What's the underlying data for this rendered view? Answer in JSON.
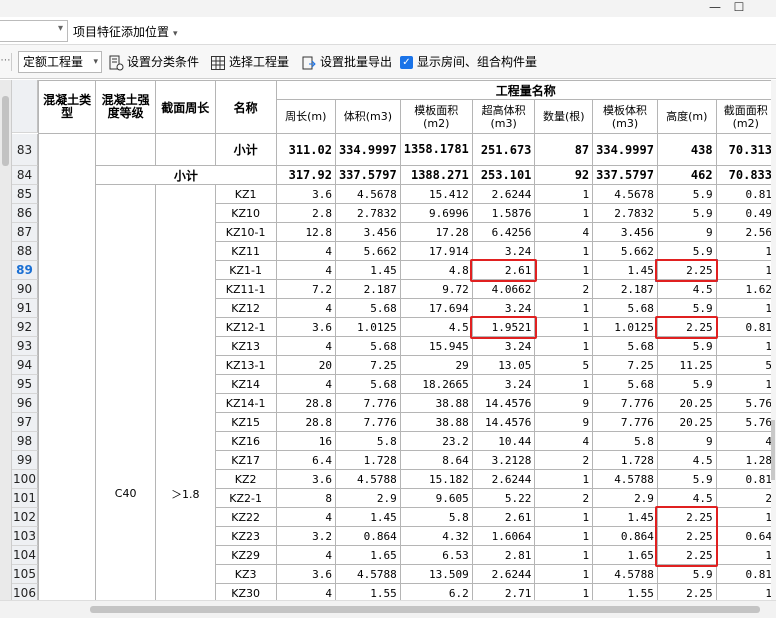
{
  "window": {
    "minimize": "—",
    "maximize": "☐"
  },
  "filter": {
    "label": "项目特征添加位置",
    "dropdown": "▾"
  },
  "toolbar": {
    "combo_value": "定额工程量",
    "set_category": "设置分类条件",
    "select_quantity": "选择工程量",
    "batch_export": "设置批量导出",
    "show_rooms": "显示房间、组合构件量",
    "show_rooms_checked": true
  },
  "table": {
    "headers": {
      "concrete_type": "混凝土类型",
      "concrete_grade": "混凝土强度等级",
      "perimeter": "截面周长",
      "name": "名称",
      "group": "工程量名称"
    },
    "columns": [
      "周长(m)",
      "体积(m3)",
      "模板面积(m2)",
      "超高体积(m3)",
      "数量(根)",
      "模板体积(m3)",
      "高度(m)",
      "截面面积(m2)"
    ],
    "subtotal_label": "小计",
    "grade": "C40",
    "perimeter_value": "＞1.8",
    "rows": [
      {
        "no": "83",
        "kind": "subtotal3",
        "label": "小计",
        "v": [
          "311.02",
          "334.9997",
          "1358.1781",
          "251.673",
          "87",
          "334.9997",
          "438",
          "70.313"
        ]
      },
      {
        "no": "84",
        "kind": "subtotal2",
        "label": "小计",
        "v": [
          "317.92",
          "337.5797",
          "1388.271",
          "253.101",
          "92",
          "337.5797",
          "462",
          "70.833"
        ]
      },
      {
        "no": "85",
        "name": "KZ1",
        "v": [
          "3.6",
          "4.5678",
          "15.412",
          "2.6244",
          "1",
          "4.5678",
          "5.9",
          "0.81"
        ]
      },
      {
        "no": "86",
        "name": "KZ10",
        "v": [
          "2.8",
          "2.7832",
          "9.6996",
          "1.5876",
          "1",
          "2.7832",
          "5.9",
          "0.49"
        ]
      },
      {
        "no": "87",
        "name": "KZ10-1",
        "v": [
          "12.8",
          "3.456",
          "17.28",
          "6.4256",
          "4",
          "3.456",
          "9",
          "2.56"
        ]
      },
      {
        "no": "88",
        "name": "KZ11",
        "v": [
          "4",
          "5.662",
          "17.914",
          "3.24",
          "1",
          "5.662",
          "5.9",
          "1"
        ]
      },
      {
        "no": "89",
        "name": "KZ1-1",
        "v": [
          "4",
          "1.45",
          "4.8",
          "2.61",
          "1",
          "1.45",
          "2.25",
          "1"
        ],
        "selected": true
      },
      {
        "no": "90",
        "name": "KZ11-1",
        "v": [
          "7.2",
          "2.187",
          "9.72",
          "4.0662",
          "2",
          "2.187",
          "4.5",
          "1.62"
        ]
      },
      {
        "no": "91",
        "name": "KZ12",
        "v": [
          "4",
          "5.68",
          "17.694",
          "3.24",
          "1",
          "5.68",
          "5.9",
          "1"
        ]
      },
      {
        "no": "92",
        "name": "KZ12-1",
        "v": [
          "3.6",
          "1.0125",
          "4.5",
          "1.9521",
          "1",
          "1.0125",
          "2.25",
          "0.81"
        ]
      },
      {
        "no": "93",
        "name": "KZ13",
        "v": [
          "4",
          "5.68",
          "15.945",
          "3.24",
          "1",
          "5.68",
          "5.9",
          "1"
        ]
      },
      {
        "no": "94",
        "name": "KZ13-1",
        "v": [
          "20",
          "7.25",
          "29",
          "13.05",
          "5",
          "7.25",
          "11.25",
          "5"
        ]
      },
      {
        "no": "95",
        "name": "KZ14",
        "v": [
          "4",
          "5.68",
          "18.2665",
          "3.24",
          "1",
          "5.68",
          "5.9",
          "1"
        ]
      },
      {
        "no": "96",
        "name": "KZ14-1",
        "v": [
          "28.8",
          "7.776",
          "38.88",
          "14.4576",
          "9",
          "7.776",
          "20.25",
          "5.76"
        ]
      },
      {
        "no": "97",
        "name": "KZ15",
        "v": [
          "28.8",
          "7.776",
          "38.88",
          "14.4576",
          "9",
          "7.776",
          "20.25",
          "5.76"
        ]
      },
      {
        "no": "98",
        "name": "KZ16",
        "v": [
          "16",
          "5.8",
          "23.2",
          "10.44",
          "4",
          "5.8",
          "9",
          "4"
        ]
      },
      {
        "no": "99",
        "name": "KZ17",
        "v": [
          "6.4",
          "1.728",
          "8.64",
          "3.2128",
          "2",
          "1.728",
          "4.5",
          "1.28"
        ]
      },
      {
        "no": "100",
        "name": "KZ2",
        "v": [
          "3.6",
          "4.5788",
          "15.182",
          "2.6244",
          "1",
          "4.5788",
          "5.9",
          "0.81"
        ]
      },
      {
        "no": "101",
        "name": "KZ2-1",
        "v": [
          "8",
          "2.9",
          "9.605",
          "5.22",
          "2",
          "2.9",
          "4.5",
          "2"
        ]
      },
      {
        "no": "102",
        "name": "KZ22",
        "v": [
          "4",
          "1.45",
          "5.8",
          "2.61",
          "1",
          "1.45",
          "2.25",
          "1"
        ]
      },
      {
        "no": "103",
        "name": "KZ23",
        "v": [
          "3.2",
          "0.864",
          "4.32",
          "1.6064",
          "1",
          "0.864",
          "2.25",
          "0.64"
        ]
      },
      {
        "no": "104",
        "name": "KZ29",
        "v": [
          "4",
          "1.65",
          "6.53",
          "2.81",
          "1",
          "1.65",
          "2.25",
          "1"
        ]
      },
      {
        "no": "105",
        "name": "KZ3",
        "v": [
          "3.6",
          "4.5788",
          "13.509",
          "2.6244",
          "1",
          "4.5788",
          "5.9",
          "0.81"
        ]
      },
      {
        "no": "106",
        "name": "KZ30",
        "v": [
          "4",
          "1.55",
          "6.2",
          "2.71",
          "1",
          "1.55",
          "2.25",
          "1"
        ]
      }
    ]
  },
  "colors": {
    "highlight": "#e02020",
    "selection": "#4a90e2",
    "checkbox": "#1a73e8"
  }
}
